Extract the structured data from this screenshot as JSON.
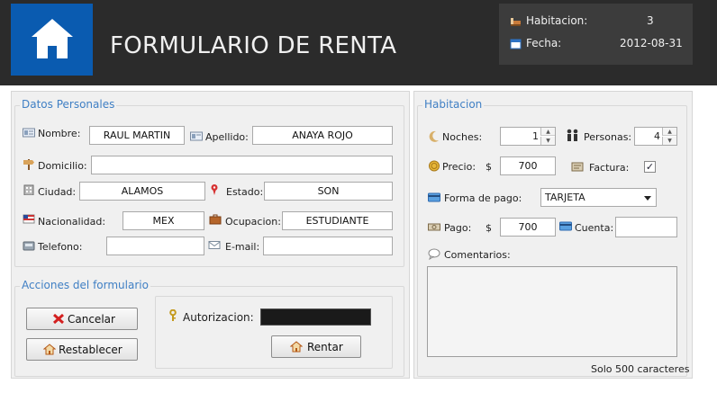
{
  "header": {
    "title": "FORMULARIO DE RENTA",
    "info": {
      "habitacion_label": "Habitacion:",
      "habitacion_value": "3",
      "fecha_label": "Fecha:",
      "fecha_value": "2012-08-31"
    }
  },
  "personal": {
    "legend": "Datos Personales",
    "nombre_label": "Nombre:",
    "nombre_value": "RAUL MARTIN",
    "apellido_label": "Apellido:",
    "apellido_value": "ANAYA ROJO",
    "domicilio_label": "Domicilio:",
    "domicilio_value": "",
    "ciudad_label": "Ciudad:",
    "ciudad_value": "ALAMOS",
    "estado_label": "Estado:",
    "estado_value": "SON",
    "nacionalidad_label": "Nacionalidad:",
    "nacionalidad_value": "MEX",
    "ocupacion_label": "Ocupacion:",
    "ocupacion_value": "ESTUDIANTE",
    "telefono_label": "Telefono:",
    "telefono_value": "",
    "email_label": "E-mail:",
    "email_value": ""
  },
  "actions": {
    "legend": "Acciones del formulario",
    "cancel_label": "Cancelar",
    "reset_label": "Restablecer",
    "auth_label": "Autorizacion:",
    "rent_label": "Rentar"
  },
  "room": {
    "legend": "Habitacion",
    "noches_label": "Noches:",
    "noches_value": "1",
    "personas_label": "Personas:",
    "personas_value": "4",
    "precio_label": "Precio:",
    "currency": "$",
    "precio_value": "700",
    "factura_label": "Factura:",
    "factura_checked": "✓",
    "forma_pago_label": "Forma de pago:",
    "forma_pago_value": "TARJETA",
    "pago_label": "Pago:",
    "pago_value": "700",
    "cuenta_label": "Cuenta:",
    "cuenta_value": "",
    "comentarios_label": "Comentarios:",
    "comentarios_value": "",
    "char_limit": "Solo 500 caracteres"
  },
  "colors": {
    "header_bg": "#2b2b2b",
    "home_tile": "#0a5bb0",
    "legend_text": "#3f7fc4",
    "panel_bg": "#f0f0f0"
  },
  "icons": [
    "home-icon",
    "bed-icon",
    "calendar-icon",
    "id-card-icon",
    "signpost-icon",
    "building-icon",
    "map-pin-icon",
    "flag-icon",
    "briefcase-icon",
    "phone-icon",
    "envelope-icon",
    "x-icon",
    "house-icon",
    "key-icon",
    "moon-icon",
    "people-icon",
    "coin-icon",
    "invoice-icon",
    "card-icon",
    "cash-icon",
    "speech-icon"
  ]
}
